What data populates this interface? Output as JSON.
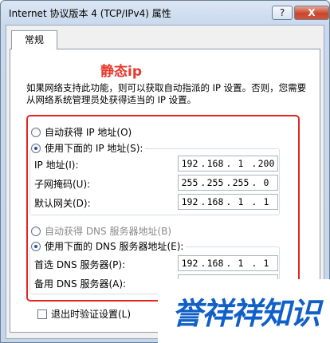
{
  "window": {
    "title": "Internet 协议版本 4 (TCP/IPv4) 属性",
    "help_label": "?",
    "close_label": "X"
  },
  "tabs": [
    {
      "label": "常规"
    }
  ],
  "annotation": {
    "text": "静态ip",
    "color": "#e8382d"
  },
  "description": "如果网络支持此功能，则可以获取自动指派的 IP 设置。否则，您需要从网络系统管理员处获得适当的 IP 设置。",
  "ip_section": {
    "auto_label": "自动获得 IP 地址(O)",
    "manual_label": "使用下面的 IP 地址(S):",
    "selected": "manual",
    "fields": [
      {
        "label": "IP 地址(I):",
        "octets": [
          "192",
          "168",
          "1",
          "200"
        ]
      },
      {
        "label": "子网掩码(U):",
        "octets": [
          "255",
          "255",
          "255",
          "0"
        ]
      },
      {
        "label": "默认网关(D):",
        "octets": [
          "192",
          "168",
          "1",
          "1"
        ]
      }
    ]
  },
  "dns_section": {
    "auto_label": "自动获得 DNS 服务器地址(B)",
    "auto_disabled": true,
    "manual_label": "使用下面的 DNS 服务器地址(E):",
    "selected": "manual",
    "fields": [
      {
        "label": "首选 DNS 服务器(P):",
        "octets": [
          "192",
          "168",
          "1",
          "1"
        ]
      },
      {
        "label": "备用 DNS 服务器(A):",
        "octets": [
          "",
          "",
          "",
          ""
        ]
      }
    ]
  },
  "validate_on_exit": {
    "label": "退出时验证设置(L)",
    "checked": false
  },
  "watermark": {
    "text": "誉祥祥知识",
    "color": "#1060c8"
  }
}
